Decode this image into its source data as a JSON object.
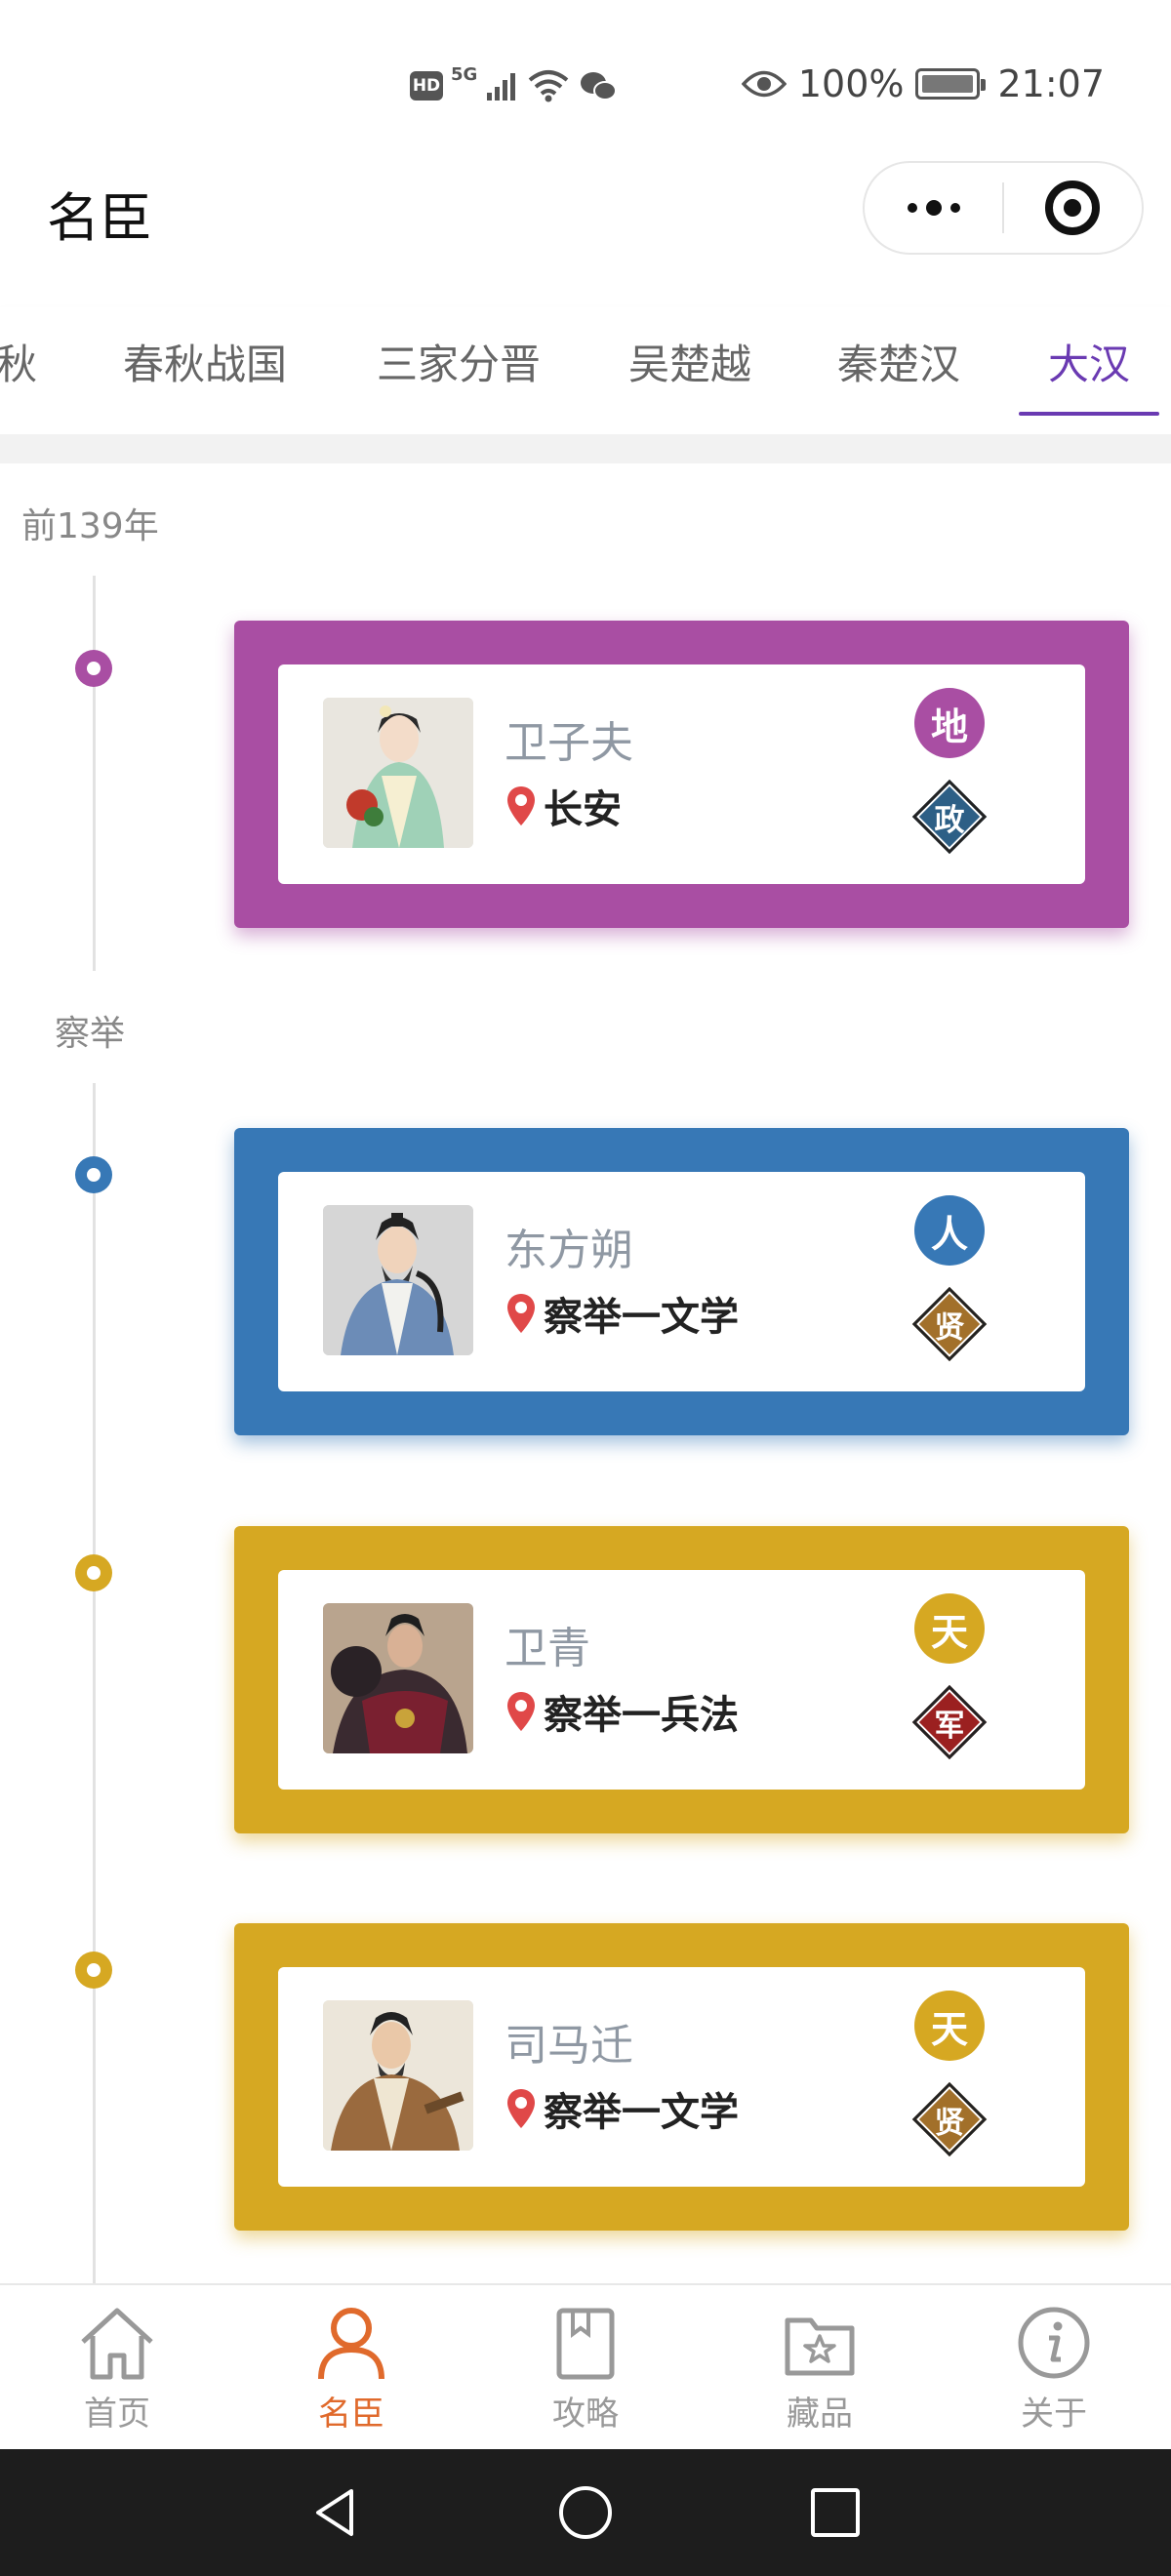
{
  "status_bar": {
    "hd": "HD",
    "net_5g": "5G",
    "battery": "100%",
    "time": "21:07"
  },
  "header": {
    "title": "名臣"
  },
  "tabs": [
    {
      "label": "秋",
      "active": false
    },
    {
      "label": "春秋战国",
      "active": false
    },
    {
      "label": "三家分晋",
      "active": false
    },
    {
      "label": "吴楚越",
      "active": false
    },
    {
      "label": "秦楚汉",
      "active": false
    },
    {
      "label": "大汉",
      "active": true
    }
  ],
  "timeline": {
    "groups": [
      {
        "label": "前139年"
      },
      {
        "label": "察举"
      }
    ],
    "cards": [
      {
        "name": "卫子夫",
        "location": "长安",
        "rank": "地",
        "role": "政",
        "color": "#a94ea3",
        "role_color": "#2d5f86"
      },
      {
        "name": "东方朔",
        "location": "察举一文学",
        "rank": "人",
        "role": "贤",
        "color": "#3778b6",
        "role_color": "#a2702a"
      },
      {
        "name": "卫青",
        "location": "察举一兵法",
        "rank": "天",
        "role": "军",
        "color": "#d6a822",
        "role_color": "#9b2020"
      },
      {
        "name": "司马迁",
        "location": "察举一文学",
        "rank": "天",
        "role": "贤",
        "color": "#d6a822",
        "role_color": "#a2702a"
      }
    ]
  },
  "bottom_nav": [
    {
      "label": "首页",
      "icon": "home-icon",
      "active": false
    },
    {
      "label": "名臣",
      "icon": "person-icon",
      "active": true
    },
    {
      "label": "攻略",
      "icon": "book-icon",
      "active": false
    },
    {
      "label": "藏品",
      "icon": "star-folder-icon",
      "active": false
    },
    {
      "label": "关于",
      "icon": "info-icon",
      "active": false
    }
  ],
  "colors": {
    "accent": "#6a3ab2",
    "nav_active": "#e06a2c",
    "pin": "#e04848"
  }
}
